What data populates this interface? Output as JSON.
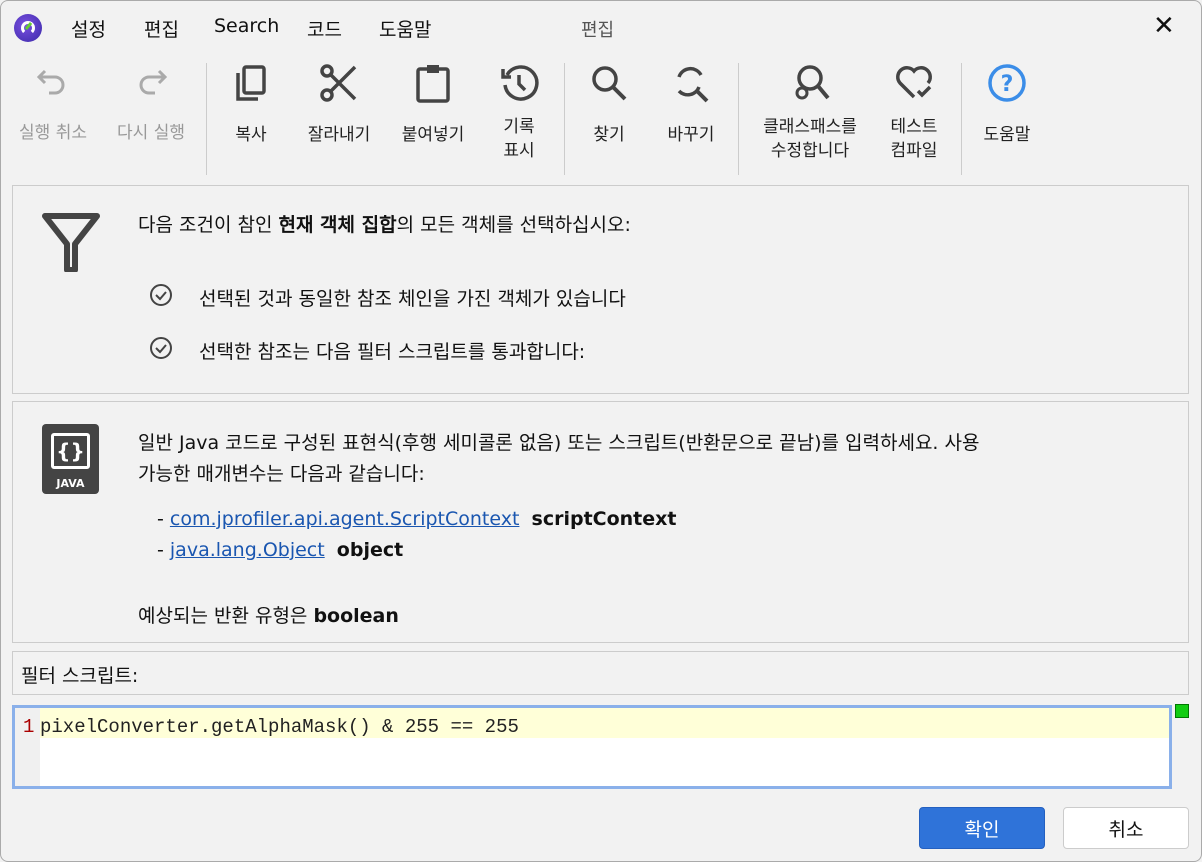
{
  "menu": [
    "설정",
    "편집",
    "Search",
    "코드",
    "도움말"
  ],
  "window_title": "편집",
  "toolbar": {
    "undo": "실행 취소",
    "redo": "다시 실행",
    "copy": "복사",
    "cut": "잘라내기",
    "paste": "붙여넣기",
    "history1": "기록",
    "history2": "표시",
    "find": "찾기",
    "replace": "바꾸기",
    "classpath1": "클래스패스를",
    "classpath2": "수정합니다",
    "compile1": "테스트",
    "compile2": "컴파일",
    "help": "도움말"
  },
  "filter": {
    "pre": "다음 조건이 참인 ",
    "bold": "현재 객체 집합",
    "post": "의 모든 객체를 선택하십시오:",
    "cond1": "선택된 것과 동일한 참조 체인을 가진 객체가 있습니다",
    "cond2": "선택한 참조는 다음 필터 스크립트를 통과합니다:"
  },
  "java": {
    "desc1": "일반 Java 코드로 구성된 표현식(후행 세미콜론 없음) 또는 스크립트(반환문으로 끝남)를 입력하세요. 사용",
    "desc2": "가능한 매개변수는 다음과 같습니다:",
    "p1_type": "com.jprofiler.api.agent.ScriptContext",
    "p1_name": "scriptContext",
    "p2_type": "java.lang.Object",
    "p2_name": "object",
    "ret_pre": "예상되는 반환 유형은 ",
    "ret_type": "boolean",
    "dash": "-",
    "logo": "JAVA"
  },
  "script_label": "필터 스크립트:",
  "editor": {
    "line": "1",
    "code": "pixelConverter.getAlphaMask() & 255 == 255"
  },
  "buttons": {
    "ok": "확인",
    "cancel": "취소"
  }
}
